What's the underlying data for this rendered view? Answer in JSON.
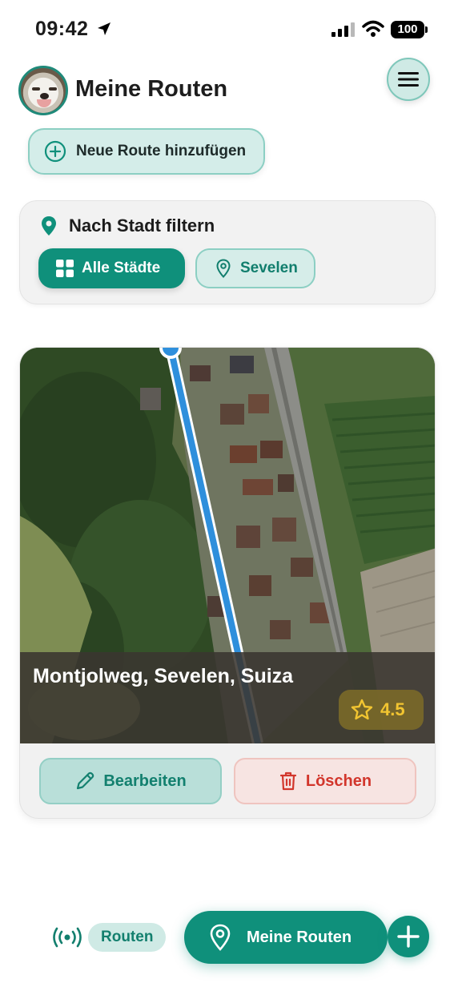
{
  "status_bar": {
    "time": "09:42",
    "battery": "100",
    "icons": [
      "location-arrow-icon",
      "signal-icon",
      "wifi-icon",
      "battery-icon"
    ]
  },
  "header": {
    "title": "Meine Routen",
    "avatar": "dog-avatar",
    "menu_icon": "hamburger-icon"
  },
  "actions": {
    "add_route_label": "Neue Route hinzufügen",
    "add_icon": "plus-circle-icon"
  },
  "filter": {
    "title": "Nach Stadt filtern",
    "title_icon": "map-pin-icon",
    "chips": [
      {
        "label": "Alle Städte",
        "icon": "grid-icon",
        "selected": true
      },
      {
        "label": "Sevelen",
        "icon": "map-pin-icon",
        "selected": false
      }
    ]
  },
  "route_card": {
    "name": "Montjolweg, Sevelen, Suiza",
    "rating": "4.5",
    "rating_icon": "star-icon",
    "edit_label": "Bearbeiten",
    "edit_icon": "pencil-icon",
    "delete_label": "Löschen",
    "delete_icon": "trash-icon"
  },
  "bottom_nav": {
    "routes_label": "Routen",
    "routes_icon": "broadcast-icon",
    "main_label": "Meine Routen",
    "main_icon": "map-pin-icon",
    "plus_icon": "plus-icon"
  },
  "colors": {
    "accent": "#0f907b",
    "accent_light": "#cfeae5",
    "danger": "#d2362c",
    "star": "#f2c531",
    "route_line": "#2e8fdc"
  }
}
